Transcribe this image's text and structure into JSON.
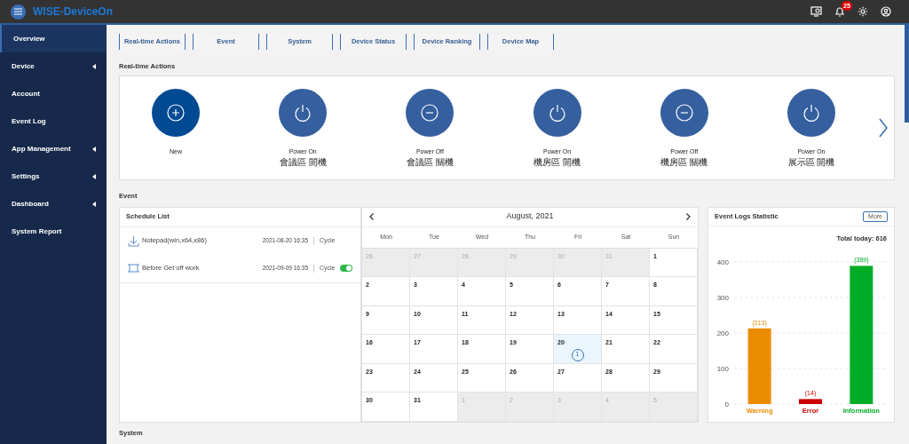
{
  "header": {
    "app_name": "WISE-DeviceOn",
    "notification_count": "25"
  },
  "sidebar": {
    "items": [
      {
        "label": "Overview",
        "selected": true,
        "submenu": false
      },
      {
        "label": "Device",
        "selected": false,
        "submenu": true
      },
      {
        "label": "Account",
        "selected": false,
        "submenu": false
      },
      {
        "label": "Event Log",
        "selected": false,
        "submenu": false
      },
      {
        "label": "App Management",
        "selected": false,
        "submenu": true
      },
      {
        "label": "Settings",
        "selected": false,
        "submenu": true
      },
      {
        "label": "Dashboard",
        "selected": false,
        "submenu": true
      },
      {
        "label": "System Report",
        "selected": false,
        "submenu": false
      }
    ]
  },
  "tabs": [
    "Real-time Actions",
    "Event",
    "System",
    "Device Status",
    "Device Ranking",
    "Device Map"
  ],
  "realtime_actions": {
    "title": "Real-time Actions",
    "actions": [
      {
        "kind": "new",
        "label": "New"
      },
      {
        "kind": "power_on",
        "label": "Power On",
        "sublabel": "會議區 開機"
      },
      {
        "kind": "power_off",
        "label": "Power Off",
        "sublabel": "會議區 關機"
      },
      {
        "kind": "power_on",
        "label": "Power On",
        "sublabel": "機房區 開機"
      },
      {
        "kind": "power_off",
        "label": "Power Off",
        "sublabel": "機房區 關機"
      },
      {
        "kind": "power_on",
        "label": "Power On",
        "sublabel": "展示區 開機"
      }
    ]
  },
  "event": {
    "title": "Event",
    "schedule_list": {
      "title": "Schedule List",
      "items": [
        {
          "kind": "download",
          "name": "Notepad(win,x64,x86)",
          "datetime": "2021-08-20 16:35",
          "cycle": "Cycle"
        },
        {
          "kind": "frame",
          "name": "Before Get off work",
          "datetime": "2021-09-09 16:35",
          "cycle": "Cycle",
          "on": true
        }
      ]
    },
    "calendar": {
      "month": "August, 2021",
      "weekdays": [
        "Mon",
        "Tue",
        "Wed",
        "Thu",
        "Fri",
        "Sat",
        "Sun"
      ],
      "weeks": [
        [
          {
            "day": "26",
            "in_month": false,
            "selected": false
          },
          {
            "day": "27",
            "in_month": false,
            "selected": false
          },
          {
            "day": "28",
            "in_month": false,
            "selected": false
          },
          {
            "day": "29",
            "in_month": false,
            "selected": false
          },
          {
            "day": "30",
            "in_month": false,
            "selected": false
          },
          {
            "day": "31",
            "in_month": false,
            "selected": false
          },
          {
            "day": "1",
            "in_month": true,
            "selected": false
          }
        ],
        [
          {
            "day": "2",
            "in_month": true,
            "selected": false
          },
          {
            "day": "3",
            "in_month": true,
            "selected": false
          },
          {
            "day": "4",
            "in_month": true,
            "selected": false
          },
          {
            "day": "5",
            "in_month": true,
            "selected": false
          },
          {
            "day": "6",
            "in_month": true,
            "selected": false
          },
          {
            "day": "7",
            "in_month": true,
            "selected": false
          },
          {
            "day": "8",
            "in_month": true,
            "selected": false
          }
        ],
        [
          {
            "day": "9",
            "in_month": true,
            "selected": false
          },
          {
            "day": "10",
            "in_month": true,
            "selected": false
          },
          {
            "day": "11",
            "in_month": true,
            "selected": false
          },
          {
            "day": "12",
            "in_month": true,
            "selected": false
          },
          {
            "day": "13",
            "in_month": true,
            "selected": false
          },
          {
            "day": "14",
            "in_month": true,
            "selected": false
          },
          {
            "day": "15",
            "in_month": true,
            "selected": false
          }
        ],
        [
          {
            "day": "16",
            "in_month": true,
            "selected": false
          },
          {
            "day": "17",
            "in_month": true,
            "selected": false
          },
          {
            "day": "18",
            "in_month": true,
            "selected": false
          },
          {
            "day": "19",
            "in_month": true,
            "selected": false
          },
          {
            "day": "20",
            "in_month": true,
            "selected": true,
            "events": "1"
          },
          {
            "day": "21",
            "in_month": true,
            "selected": false
          },
          {
            "day": "22",
            "in_month": true,
            "selected": false
          }
        ],
        [
          {
            "day": "23",
            "in_month": true,
            "selected": false
          },
          {
            "day": "24",
            "in_month": true,
            "selected": false
          },
          {
            "day": "25",
            "in_month": true,
            "selected": false
          },
          {
            "day": "26",
            "in_month": true,
            "selected": false
          },
          {
            "day": "27",
            "in_month": true,
            "selected": false
          },
          {
            "day": "28",
            "in_month": true,
            "selected": false
          },
          {
            "day": "29",
            "in_month": true,
            "selected": false
          }
        ],
        [
          {
            "day": "30",
            "in_month": true,
            "selected": false
          },
          {
            "day": "31",
            "in_month": true,
            "selected": false
          },
          {
            "day": "1",
            "in_month": false,
            "selected": false
          },
          {
            "day": "2",
            "in_month": false,
            "selected": false
          },
          {
            "day": "3",
            "in_month": false,
            "selected": false
          },
          {
            "day": "4",
            "in_month": false,
            "selected": false
          },
          {
            "day": "5",
            "in_month": false,
            "selected": false
          }
        ]
      ]
    },
    "statistics": {
      "title": "Event Logs Statistic",
      "more": "More",
      "total": "Total today: 616",
      "chart_data": {
        "type": "bar",
        "categories": [
          "Warning",
          "Error",
          "Information"
        ],
        "values": [
          213,
          14,
          389
        ],
        "grid": true,
        "colors": [
          "#eb8c00",
          "#cc0000",
          "#00ab26"
        ],
        "value_labels": [
          "(213)",
          "(14)",
          "(389)"
        ],
        "ylim": [
          0,
          400
        ],
        "yticks": [
          0,
          100,
          200,
          300,
          400
        ]
      }
    }
  },
  "system": {
    "title": "System"
  }
}
